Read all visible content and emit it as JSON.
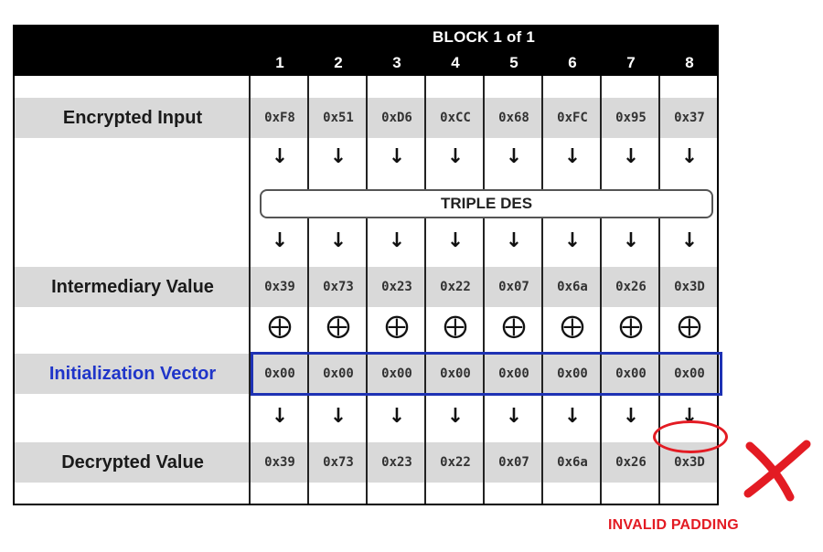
{
  "header": {
    "block_title": "BLOCK 1 of 1"
  },
  "columns": [
    "1",
    "2",
    "3",
    "4",
    "5",
    "6",
    "7",
    "8"
  ],
  "rows": {
    "encrypted_input": {
      "label": "Encrypted Input",
      "values": [
        "0xF8",
        "0x51",
        "0xD6",
        "0xCC",
        "0x68",
        "0xFC",
        "0x95",
        "0x37"
      ]
    },
    "intermediary_value": {
      "label": "Intermediary Value",
      "values": [
        "0x39",
        "0x73",
        "0x23",
        "0x22",
        "0x07",
        "0x6a",
        "0x26",
        "0x3D"
      ]
    },
    "initialization_vector": {
      "label": "Initialization Vector",
      "values": [
        "0x00",
        "0x00",
        "0x00",
        "0x00",
        "0x00",
        "0x00",
        "0x00",
        "0x00"
      ]
    },
    "decrypted_value": {
      "label": "Decrypted Value",
      "values": [
        "0x39",
        "0x73",
        "0x23",
        "0x22",
        "0x07",
        "0x6a",
        "0x26",
        "0x3D"
      ]
    }
  },
  "cipher_box": {
    "label": "TRIPLE DES"
  },
  "symbols": {
    "arrow": "↓",
    "xor": "⨁"
  },
  "status": {
    "text": "INVALID PADDING",
    "mark_icon": "x-mark-icon"
  },
  "colors": {
    "iv_highlight": "#1e32b4",
    "error": "#e31b23",
    "band": "#d9d9d9",
    "header": "#000000"
  }
}
